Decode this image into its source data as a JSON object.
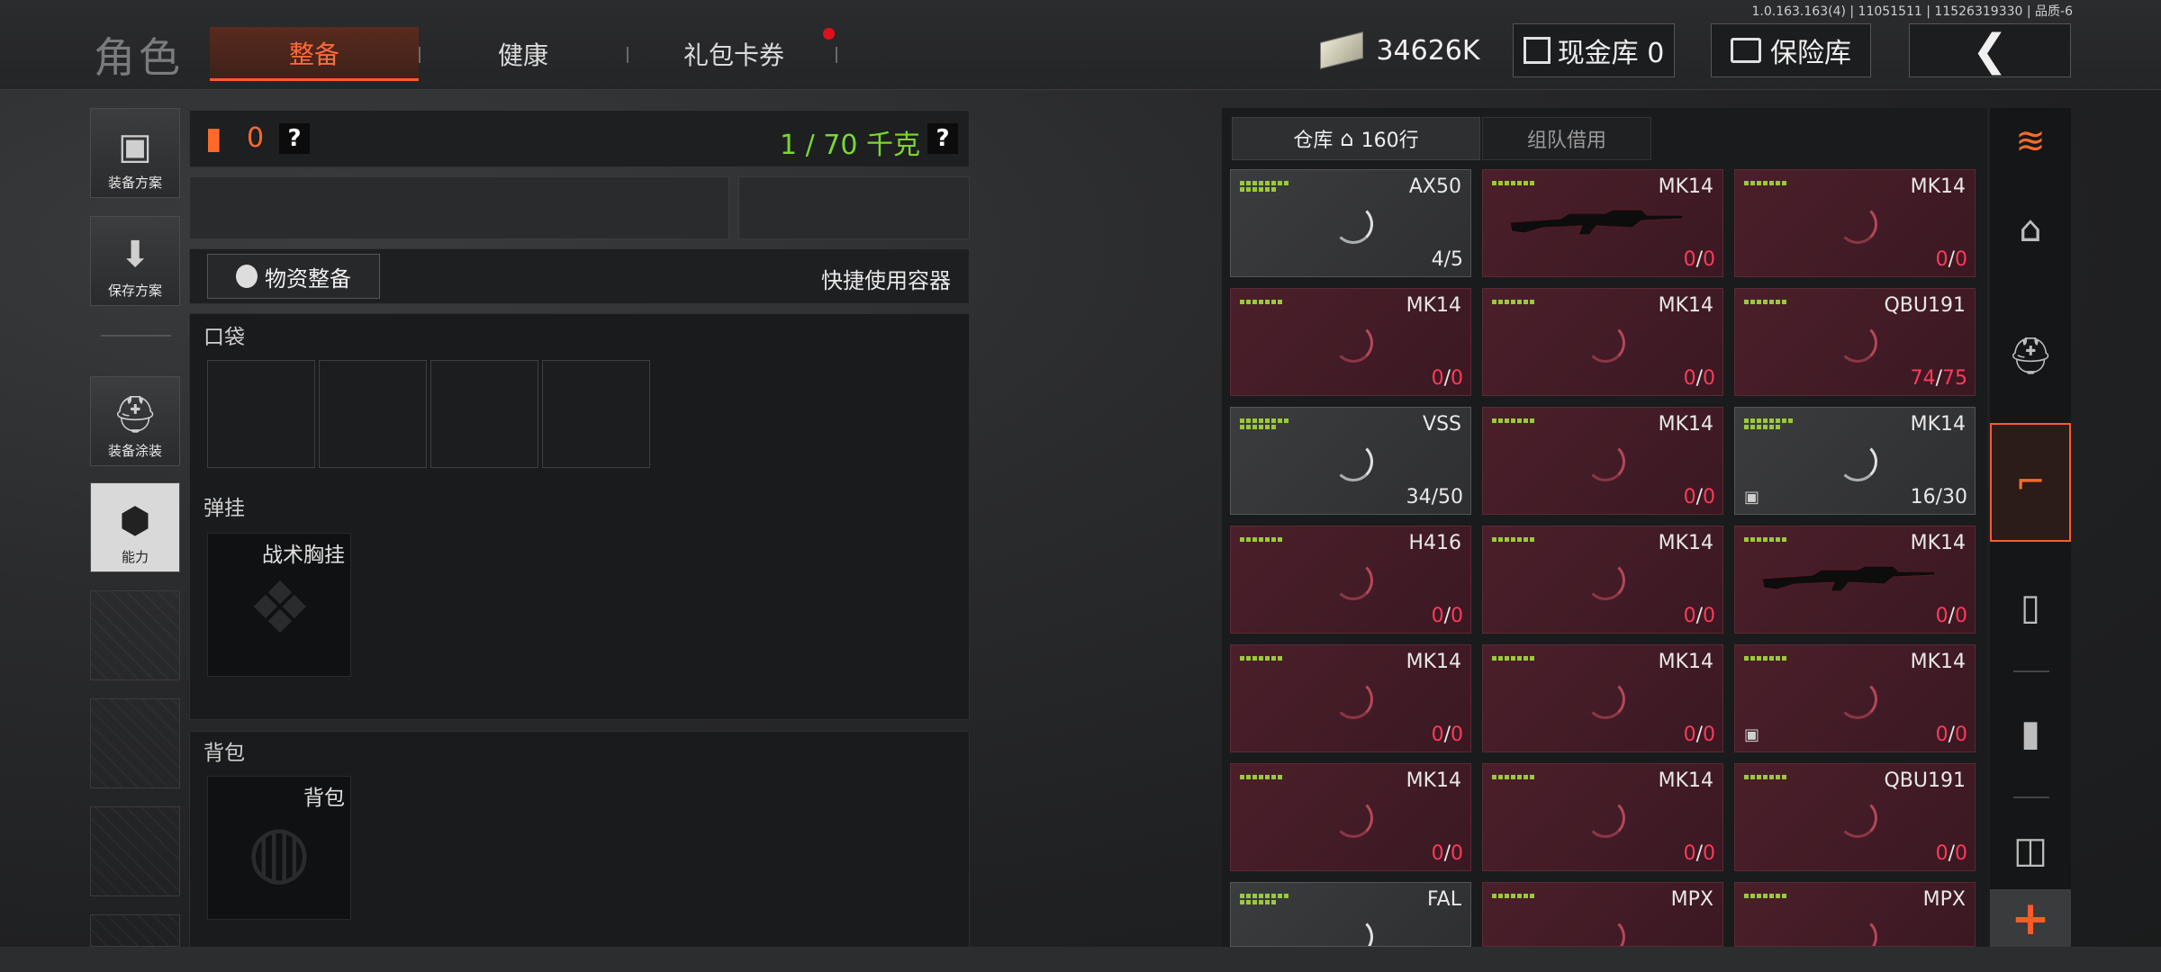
{
  "version": "1.0.163.163(4) | 11051511 | 11526319330 | 品质-6",
  "header": {
    "title": "角色",
    "tabs": [
      {
        "label": "整备",
        "active": true
      },
      {
        "label": "健康",
        "active": false
      },
      {
        "label": "礼包卡券",
        "active": false,
        "badge": true
      }
    ],
    "money": "34626K",
    "cash_label": "现金库 0",
    "safe_label": "保险库",
    "back_icon": "back-chevron-icon"
  },
  "sidebar": {
    "items": [
      {
        "label": "装备方案",
        "icon": "vest-icon"
      },
      {
        "label": "保存方案",
        "icon": "download-icon"
      },
      {
        "label": "装备涂装",
        "icon": "helmet-icon"
      },
      {
        "label": "能力",
        "icon": "ability-icon"
      }
    ]
  },
  "loadout": {
    "armor_count": "0",
    "weight": "1 / 70 千克",
    "help": "?",
    "supply_button": "物资整备",
    "quick_use": "快捷使用容器",
    "pocket_label": "口袋",
    "rig_section": "弹挂",
    "rig_name": "战术胸挂",
    "backpack_section": "背包",
    "backpack_name": "背包"
  },
  "warehouse": {
    "tab_storage": "仓库",
    "rows": "160行",
    "tab_team": "组队借用",
    "items": [
      {
        "name": "AX50",
        "cur": "4",
        "max": "5",
        "style": "grey",
        "gun": false,
        "box": false
      },
      {
        "name": "MK14",
        "cur": "0",
        "max": "0",
        "style": "red",
        "gun": true,
        "box": false
      },
      {
        "name": "MK14",
        "cur": "0",
        "max": "0",
        "style": "red",
        "gun": false,
        "box": false
      },
      {
        "name": "MK14",
        "cur": "0",
        "max": "0",
        "style": "red",
        "gun": false,
        "box": false
      },
      {
        "name": "MK14",
        "cur": "0",
        "max": "0",
        "style": "red",
        "gun": false,
        "box": false
      },
      {
        "name": "QBU191",
        "cur": "74",
        "max": "75",
        "style": "red",
        "gun": false,
        "box": false
      },
      {
        "name": "VSS",
        "cur": "34",
        "max": "50",
        "style": "grey",
        "gun": false,
        "box": false
      },
      {
        "name": "MK14",
        "cur": "0",
        "max": "0",
        "style": "red",
        "gun": false,
        "box": false
      },
      {
        "name": "MK14",
        "cur": "16",
        "max": "30",
        "style": "grey",
        "gun": false,
        "box": true
      },
      {
        "name": "H416",
        "cur": "0",
        "max": "0",
        "style": "red",
        "gun": false,
        "box": false
      },
      {
        "name": "MK14",
        "cur": "0",
        "max": "0",
        "style": "red",
        "gun": false,
        "box": false
      },
      {
        "name": "MK14",
        "cur": "0",
        "max": "0",
        "style": "red",
        "gun": true,
        "box": false
      },
      {
        "name": "MK14",
        "cur": "0",
        "max": "0",
        "style": "red",
        "gun": false,
        "box": false
      },
      {
        "name": "MK14",
        "cur": "0",
        "max": "0",
        "style": "red",
        "gun": false,
        "box": false
      },
      {
        "name": "MK14",
        "cur": "0",
        "max": "0",
        "style": "red",
        "gun": false,
        "box": true
      },
      {
        "name": "MK14",
        "cur": "0",
        "max": "0",
        "style": "red",
        "gun": false,
        "box": false
      },
      {
        "name": "MK14",
        "cur": "0",
        "max": "0",
        "style": "red",
        "gun": false,
        "box": false
      },
      {
        "name": "QBU191",
        "cur": "0",
        "max": "0",
        "style": "red",
        "gun": false,
        "box": false
      },
      {
        "name": "FAL",
        "cur": "",
        "max": "",
        "style": "grey",
        "gun": false,
        "box": false
      },
      {
        "name": "MPX",
        "cur": "",
        "max": "",
        "style": "red",
        "gun": false,
        "box": false
      },
      {
        "name": "MPX",
        "cur": "",
        "max": "",
        "style": "red",
        "gun": false,
        "box": false
      }
    ]
  },
  "rail": {
    "icons": [
      "layers-refresh-icon",
      "home-icon",
      "helmet-icon",
      "rifle-icon",
      "magazine-icon",
      "bullet-icon",
      "scope-icon"
    ],
    "add_label": "+"
  },
  "colors": {
    "accent": "#ff5a2a",
    "weight_green": "#7ad82e",
    "ammo_red": "#ff3a5a",
    "durability_green": "#9ac93a"
  }
}
